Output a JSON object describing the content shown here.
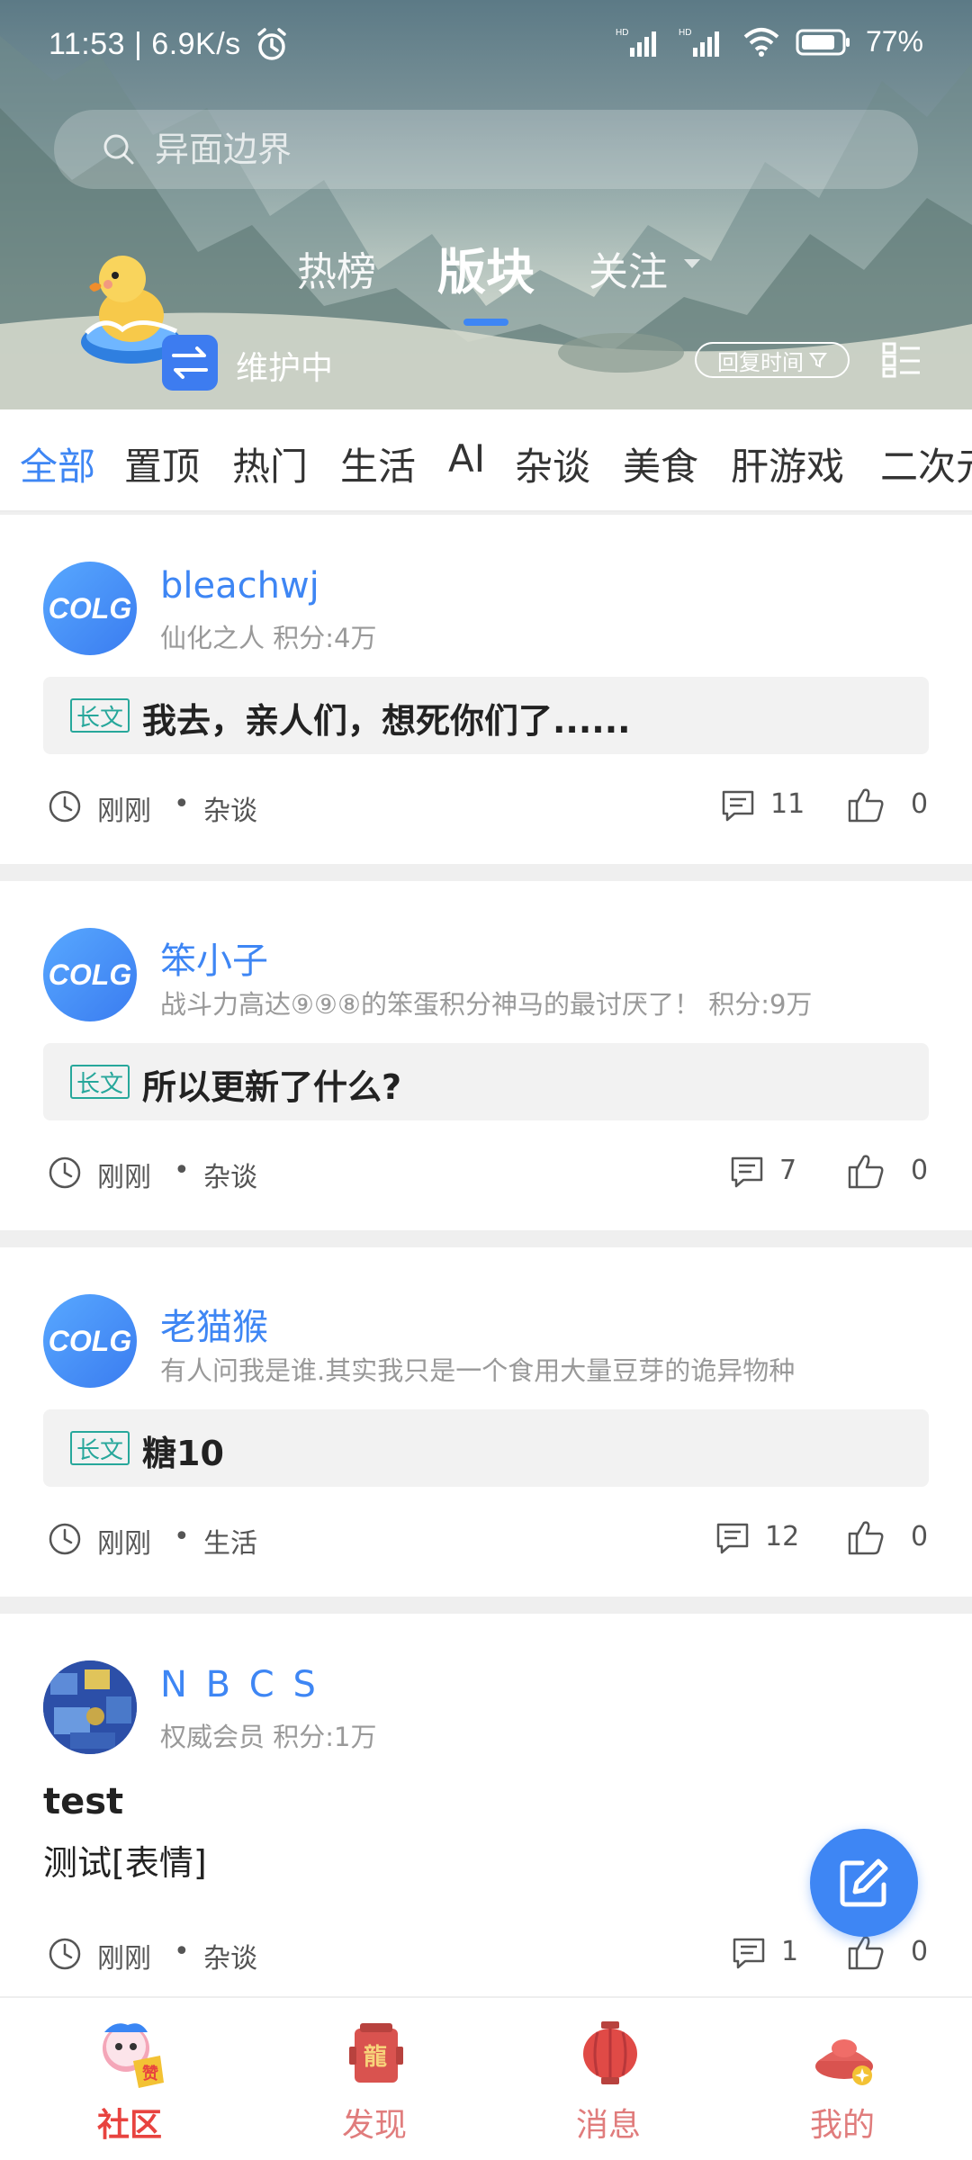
{
  "status_bar": {
    "time_speed": "11:53 | 6.9K/s",
    "battery": "77%"
  },
  "search": {
    "placeholder": "异面边界"
  },
  "top_tabs": [
    "热榜",
    "版块",
    "关注"
  ],
  "maintenance": "维护中",
  "reply_sort": "回复时间",
  "categories": [
    "全部",
    "置顶",
    "热门",
    "生活",
    "AI",
    "杂谈",
    "美食",
    "肝游戏",
    "二次元"
  ],
  "avatar_logo": "COLG",
  "posts": [
    {
      "username": "bleachwj",
      "info": "仙化之人  积分:4万",
      "tag": "长文",
      "title": "我去，亲人们，想死你们了......",
      "time": "刚刚",
      "board": "杂谈",
      "comments": "11",
      "likes": "0"
    },
    {
      "username": "笨小子",
      "info": "战斗力高达⑨⑨⑧的笨蛋积分神马的最讨厌了！  积分:9万",
      "tag": "长文",
      "title": "所以更新了什么?",
      "time": "刚刚",
      "board": "杂谈",
      "comments": "7",
      "likes": "0"
    },
    {
      "username": "老猫猴",
      "info": "有人问我是谁.其实我只是一个食用大量豆芽的诡异物种",
      "tag": "长文",
      "title": "糖10",
      "time": "刚刚",
      "board": "生活",
      "comments": "12",
      "likes": "0"
    },
    {
      "username": "N B  C S",
      "info": "权威会员  积分:1万",
      "title": "test",
      "body": "测试[表情]",
      "time": "刚刚",
      "board": "杂谈",
      "comments": "1",
      "likes": "0"
    }
  ],
  "separator_dot": "•",
  "bottom_nav": [
    "社区",
    "发现",
    "消息",
    "我的"
  ],
  "colors": {
    "accent": "#3e86f4",
    "nav_active": "#e8433f",
    "nav_inactive": "#e07c7c",
    "tag_green": "#27a79b"
  }
}
